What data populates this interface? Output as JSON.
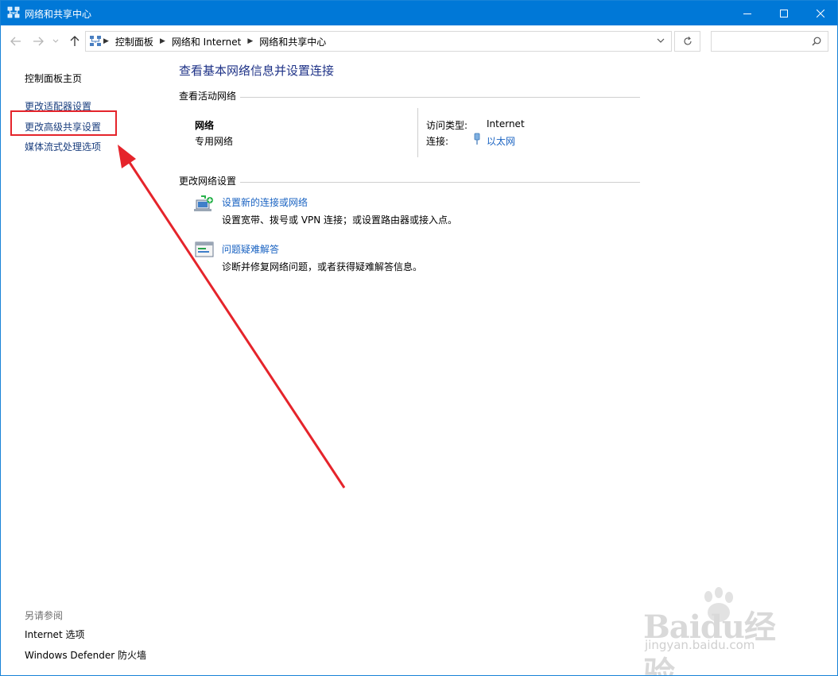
{
  "window": {
    "title": "网络和共享中心"
  },
  "address": {
    "crumbs": [
      "控制面板",
      "网络和 Internet",
      "网络和共享中心"
    ],
    "search_placeholder": ""
  },
  "left_pane": {
    "links": [
      "控制面板主页",
      "更改适配器设置",
      "更改高级共享设置",
      "媒体流式处理选项"
    ],
    "see_also_label": "另请参阅",
    "see_also_links": [
      "Internet 选项",
      "Windows Defender 防火墙"
    ]
  },
  "main": {
    "heading": "查看基本网络信息并设置连接",
    "active_networks_label": "查看活动网络",
    "network": {
      "name": "网络",
      "type": "专用网络",
      "access_type_label": "访问类型:",
      "access_type_value": "Internet",
      "connection_label": "连接:",
      "connection_value": "以太网"
    },
    "change_settings_label": "更改网络设置",
    "tasks": [
      {
        "title": "设置新的连接或网络",
        "desc": "设置宽带、拨号或 VPN 连接；或设置路由器或接入点。"
      },
      {
        "title": "问题疑难解答",
        "desc": "诊断并修复网络问题，或者获得疑难解答信息。"
      }
    ]
  },
  "watermark": {
    "brand": "Baidu经验",
    "url": "jingyan.baidu.com"
  },
  "colors": {
    "titlebar": "#0078d7",
    "link": "#1a63c2",
    "heading": "#1e3287",
    "annotation": "#e5242b"
  }
}
